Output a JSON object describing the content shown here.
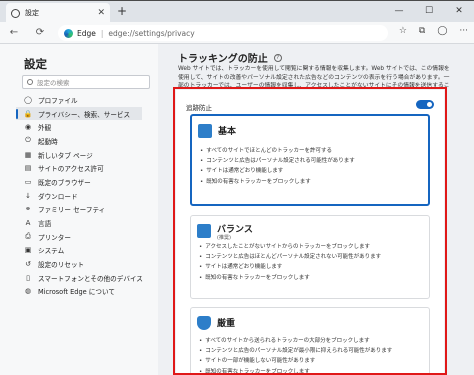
{
  "tab": {
    "title": "設定",
    "close": "✕",
    "new": "+"
  },
  "window": {
    "min": "—",
    "max": "☐",
    "close": "✕"
  },
  "toolbar": {
    "back": "←",
    "refresh": "⟳",
    "site": "Edge",
    "url": "edge://settings/privacy"
  },
  "toolbar_icons": {
    "favorite": "☆",
    "collections": "⧉",
    "profile": "◯",
    "menu": "···"
  },
  "sidebar": {
    "title": "設定",
    "search_placeholder": "設定の検索",
    "items": [
      {
        "label": "プロファイル",
        "icon": "person-icon",
        "glyph": "◯"
      },
      {
        "label": "プライバシー、検索、サービス",
        "icon": "lock-icon",
        "glyph": "🔒",
        "active": true
      },
      {
        "label": "外観",
        "icon": "appearance-icon",
        "glyph": "◉"
      },
      {
        "label": "起動時",
        "icon": "power-icon",
        "glyph": "⏻"
      },
      {
        "label": "新しいタブ ページ",
        "icon": "newtab-icon",
        "glyph": "▦"
      },
      {
        "label": "サイトのアクセス許可",
        "icon": "permissions-icon",
        "glyph": "▤"
      },
      {
        "label": "既定のブラウザー",
        "icon": "browser-icon",
        "glyph": "▭"
      },
      {
        "label": "ダウンロード",
        "icon": "download-icon",
        "glyph": "↓"
      },
      {
        "label": "ファミリー セーフティ",
        "icon": "family-icon",
        "glyph": "⚭"
      },
      {
        "label": "言語",
        "icon": "language-icon",
        "glyph": "A"
      },
      {
        "label": "プリンター",
        "icon": "printer-icon",
        "glyph": "⎙"
      },
      {
        "label": "システム",
        "icon": "system-icon",
        "glyph": "▣"
      },
      {
        "label": "設定のリセット",
        "icon": "reset-icon",
        "glyph": "↺"
      },
      {
        "label": "スマートフォンとその他のデバイス",
        "icon": "phone-icon",
        "glyph": "▯"
      },
      {
        "label": "Microsoft Edge について",
        "icon": "edge-icon",
        "glyph": "◍"
      }
    ]
  },
  "main": {
    "heading": "トラッキングの防止",
    "info": "?",
    "description": "Web サイトでは、トラッカーを使用して閲覧に関する情報を収集します。Web サイトでは、この情報を使用して、サイトの改善やパーソナル設定された広告などのコンテンツの表示を行う場合があります。一部のトラッカーでは、ユーザーの情報を収集し、アクセスしたことがないサイトにその情報を送信することがあります。",
    "toggle_label": "追跡防止",
    "toggle_on": true,
    "cards": [
      {
        "title": "基本",
        "subtitle": "",
        "selected": true,
        "icon": "basic-icon",
        "bullets": [
          "すべてのサイトでほとんどのトラッカーを許可する",
          "コンテンツと広告はパーソナル設定される可能性があります",
          "サイトは通常どおり機能します",
          "既知の有害なトラッカーをブロックします"
        ]
      },
      {
        "title": "バランス",
        "subtitle": "(推奨)",
        "selected": false,
        "icon": "balanced-icon",
        "bullets": [
          "アクセスしたことがないサイトからのトラッカーをブロックします",
          "コンテンツと広告はほとんどパーソナル設定されない可能性があります",
          "サイトは通常どおり機能します",
          "既知の有害なトラッカーをブロックします"
        ]
      },
      {
        "title": "厳重",
        "subtitle": "",
        "selected": false,
        "icon": "shield-icon",
        "bullets": [
          "すべてのサイトから送られるトラッカーの大部分をブロックします",
          "コンテンツと広告のパーソナル設定が最小限に抑えられる可能性があります",
          "サイトの一部が機能しない可能性があります",
          "既知の有害なトラッカーをブロックします"
        ]
      }
    ]
  },
  "colors": {
    "accent": "#1565c0",
    "highlight_box": "#e01818"
  }
}
